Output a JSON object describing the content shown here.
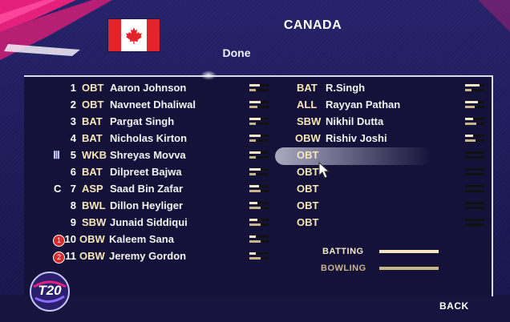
{
  "header": {
    "country": "CANADA",
    "done_label": "Done"
  },
  "left_list": [
    {
      "num": "1",
      "role": "OBT",
      "name": "Aaron Johnson",
      "bat": 0.55,
      "bowl": 0.35
    },
    {
      "num": "2",
      "role": "OBT",
      "name": "Navneet Dhaliwal",
      "bat": 0.6,
      "bowl": 0.4
    },
    {
      "num": "3",
      "role": "BAT",
      "name": "Pargat Singh",
      "bat": 0.6,
      "bowl": 0.35
    },
    {
      "num": "4",
      "role": "BAT",
      "name": "Nicholas Kirton",
      "bat": 0.6,
      "bowl": 0.35
    },
    {
      "num": "5",
      "role": "WKB",
      "name": "Shreyas Movva",
      "bat": 0.6,
      "bowl": 0.35
    },
    {
      "num": "6",
      "role": "BAT",
      "name": "Dilpreet Bajwa",
      "bat": 0.6,
      "bowl": 0.35
    },
    {
      "num": "7",
      "role": "ASP",
      "name": "Saad Bin Zafar",
      "bat": 0.5,
      "bowl": 0.6
    },
    {
      "num": "8",
      "role": "BWL",
      "name": "Dillon Heyliger",
      "bat": 0.4,
      "bowl": 0.6
    },
    {
      "num": "9",
      "role": "SBW",
      "name": "Junaid Siddiqui",
      "bat": 0.4,
      "bowl": 0.6
    },
    {
      "num": "10",
      "role": "OBW",
      "name": "Kaleem Sana",
      "bat": 0.35,
      "bowl": 0.6
    },
    {
      "num": "11",
      "role": "OBW",
      "name": "Jeremy Gordon",
      "bat": 0.35,
      "bowl": 0.6
    }
  ],
  "left_markers": {
    "row5": "Ⅲ",
    "row7": "C",
    "row10": "1",
    "row11": "2"
  },
  "right_list": [
    {
      "role": "BAT",
      "name": "R.Singh",
      "bat": 0.75,
      "bowl": 0.35
    },
    {
      "role": "ALL",
      "name": "Rayyan Pathan",
      "bat": 0.65,
      "bowl": 0.5
    },
    {
      "role": "SBW",
      "name": "Nikhil Dutta",
      "bat": 0.4,
      "bowl": 0.6
    },
    {
      "role": "OBW",
      "name": "Rishiv Joshi",
      "bat": 0.4,
      "bowl": 0.55
    },
    {
      "role": "OBT",
      "name": "",
      "bat": 0,
      "bowl": 0
    },
    {
      "role": "OBT",
      "name": "",
      "bat": 0,
      "bowl": 0
    },
    {
      "role": "OBT",
      "name": "",
      "bat": 0,
      "bowl": 0
    },
    {
      "role": "OBT",
      "name": "",
      "bat": 0,
      "bowl": 0
    },
    {
      "role": "OBT",
      "name": "",
      "bat": 0,
      "bowl": 0
    }
  ],
  "legend": {
    "batting_label": "BATTING",
    "bowling_label": "BOWLING",
    "batting_color": "#f3e8c6",
    "bowling_color": "#c9b58a"
  },
  "logo_text": "T20",
  "footer": {
    "back_label": "BACK"
  },
  "colors": {
    "role_color": "#f6e7b8",
    "accent_pink": "#e4207c"
  }
}
